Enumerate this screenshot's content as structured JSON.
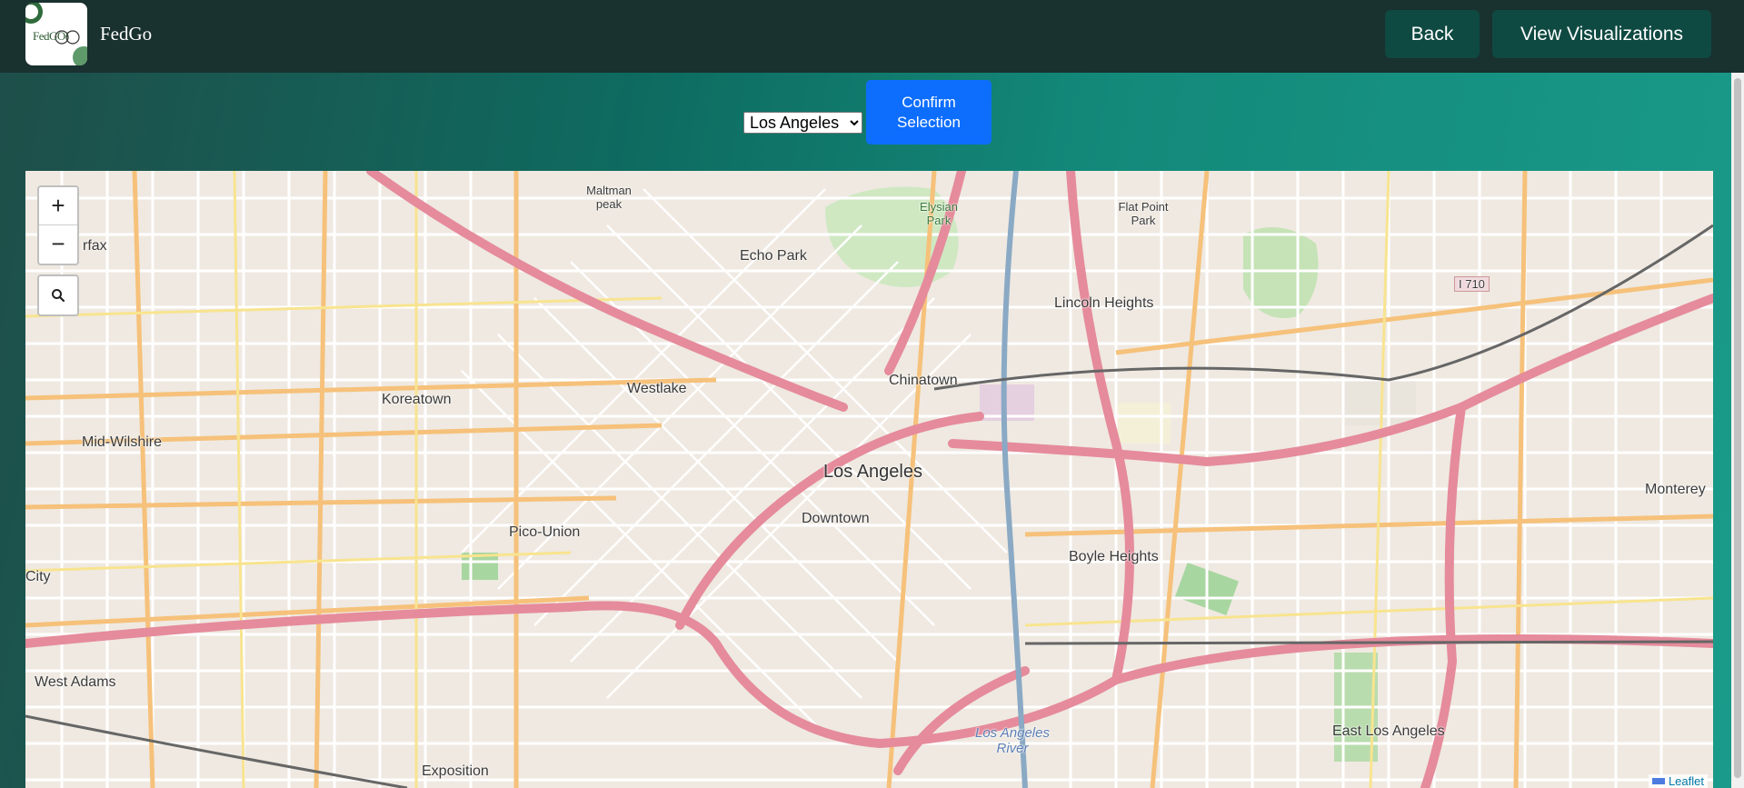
{
  "header": {
    "logo_text": "FedGO!",
    "brand": "FedGo",
    "back_label": "Back",
    "viz_label": "View Visualizations"
  },
  "selection": {
    "selected_city": "Los Angeles",
    "confirm_label": "Confirm Selection"
  },
  "map": {
    "zoom_in": "+",
    "zoom_out": "−",
    "search_icon": "magnifier-icon",
    "attribution": "Leaflet",
    "labels": {
      "los_angeles": "Los Angeles",
      "downtown": "Downtown",
      "echo_park": "Echo Park",
      "chinatown": "Chinatown",
      "lincoln_heights": "Lincoln Heights",
      "koreatown": "Koreatown",
      "westlake": "Westlake",
      "mid_wilshire": "Mid-Wilshire",
      "pico_union": "Pico-Union",
      "boyle_heights": "Boyle Heights",
      "west_adams": "West Adams",
      "exposition": "Exposition",
      "east_los_angeles": "East Los Angeles",
      "monterey": "Monterey",
      "fairfax": "rfax",
      "city": "City",
      "flat_point_park": "Flat Point Park",
      "elysian_park": "Elysian Park",
      "maltman_peak": "Maltman peak",
      "la_river": "Los Angeles River",
      "i710": "I 710"
    }
  },
  "colors": {
    "header_bg": "#19312f",
    "header_button": "#0f4a42",
    "confirm_button": "#0d6efd",
    "freeway": "#e58b9c",
    "arterial": "#f6c17a"
  }
}
